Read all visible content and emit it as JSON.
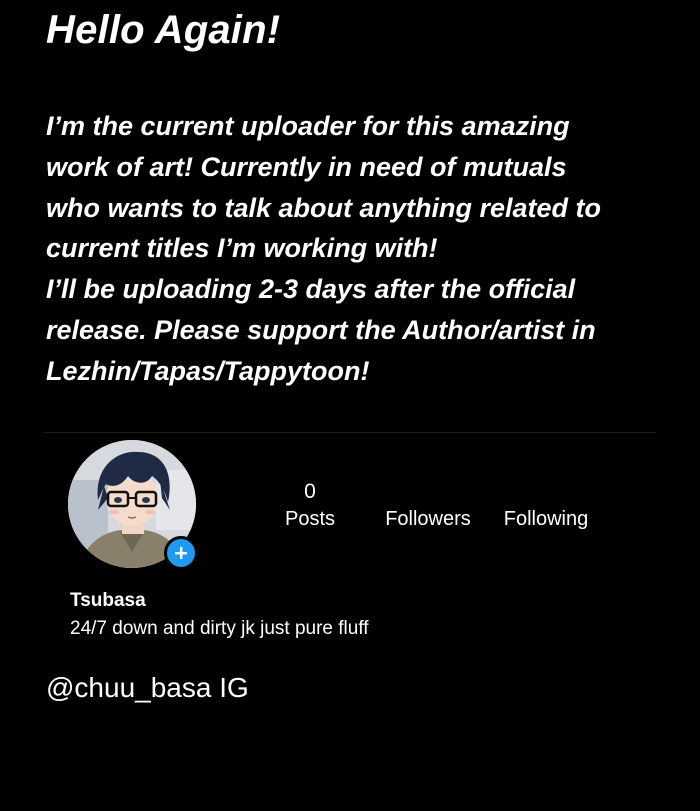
{
  "post": {
    "headline": "Hello Again!",
    "message_lines": [
      "I’m the current uploader for this amazing",
      "work of art! Currently in need of mutuals",
      "who wants to talk about anything related to",
      "current titles I’m working with!",
      "I’ll be uploading 2-3 days after the official",
      "release.  Please support the Author/artist in",
      "Lezhin/Tapas/Tappytoon!"
    ]
  },
  "profile": {
    "avatar_icon": "anime-character-avatar",
    "add_icon": "plus-icon",
    "accent_color": "#1d9bf0",
    "stats": {
      "posts_count": "0",
      "posts_label": "Posts",
      "followers_count": "",
      "followers_label": "Followers",
      "following_count": "",
      "following_label": "Following"
    },
    "name": "Tsubasa",
    "bio": "24/7 down and dirty jk just pure fluff"
  },
  "footer": {
    "handle": "@chuu_basa IG"
  }
}
